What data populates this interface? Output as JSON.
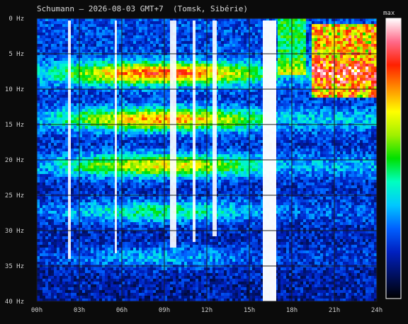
{
  "title": "Schumann — 2026-08-03 GMT+7  (Tomsk, Sibérie)",
  "colorbar": {
    "label": "max",
    "stops": [
      "#000000",
      "#001060",
      "#0020c0",
      "#0060ff",
      "#00c8ff",
      "#00ffc0",
      "#00e000",
      "#a0f000",
      "#ffff00",
      "#ff9000",
      "#ff2000",
      "#ff6a8a",
      "#ffffff"
    ]
  },
  "chart_data": {
    "type": "heatmap",
    "title": "Schumann — 2026-08-03 GMT+7  (Tomsk, Sibérie)",
    "x_ticks": [
      "00h",
      "03h",
      "06h",
      "09h",
      "12h",
      "15h",
      "18h",
      "21h",
      "24h"
    ],
    "y_ticks": [
      "0 Hz",
      "5 Hz",
      "10 Hz",
      "15 Hz",
      "20 Hz",
      "25 Hz",
      "30 Hz",
      "35 Hz",
      "40 Hz"
    ],
    "xlim_hours": [
      0,
      24
    ],
    "ylim_hz": [
      0,
      40
    ],
    "grid": true,
    "bands_hz": [
      {
        "center": 7.8,
        "strength": 0.55
      },
      {
        "center": 14.3,
        "strength": 0.5
      },
      {
        "center": 20.8,
        "strength": 0.45
      },
      {
        "center": 27.3,
        "strength": 0.25
      },
      {
        "center": 33.8,
        "strength": 0.15
      }
    ],
    "white_bursts_hours": [
      {
        "start": 2.2,
        "end": 2.4
      },
      {
        "start": 5.5,
        "end": 5.65
      },
      {
        "start": 9.4,
        "end": 9.85
      },
      {
        "start": 11.0,
        "end": 11.2
      },
      {
        "start": 12.4,
        "end": 12.7
      },
      {
        "start": 15.95,
        "end": 16.9
      }
    ],
    "high_activity_hours": [
      19.5,
      24
    ],
    "high_activity_hz": [
      1,
      11
    ]
  }
}
